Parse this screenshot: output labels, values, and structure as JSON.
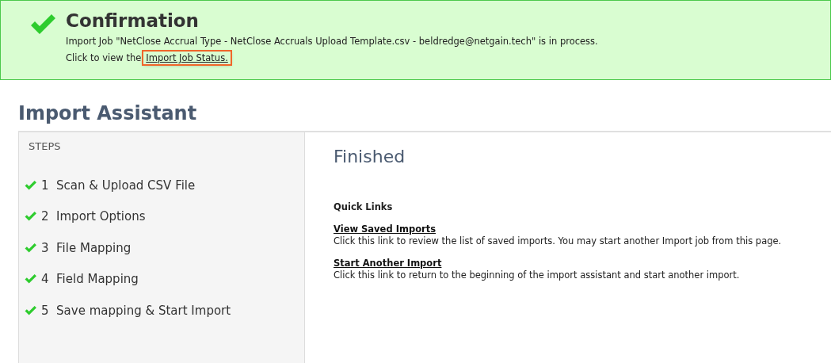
{
  "confirmation": {
    "title": "Confirmation",
    "message": "Import Job \"NetClose Accrual Type - NetClose Accruals Upload Template.csv - beldredge@netgain.tech\" is in process.",
    "link_prefix": "Click to view the",
    "link": "Import Job Status.",
    "link_highlighted": true
  },
  "page_title": "Import Assistant",
  "steps": {
    "heading": "STEPS",
    "items": [
      {
        "label": "1  Scan & Upload CSV File",
        "completed": true
      },
      {
        "label": "2  Import Options",
        "completed": true
      },
      {
        "label": "3  File Mapping",
        "completed": true
      },
      {
        "label": "4  Field Mapping",
        "completed": true
      },
      {
        "label": "5  Save mapping & Start Import",
        "completed": true
      }
    ]
  },
  "content": {
    "title": "Finished",
    "quick_links_heading": "Quick Links",
    "links": [
      {
        "label": "View Saved Imports",
        "description": "Click this link to review the list of saved imports. You may start another Import job from this page."
      },
      {
        "label": "Start Another Import",
        "description": "Click this link to return to the beginning of the import assistant and start another import."
      }
    ]
  }
}
